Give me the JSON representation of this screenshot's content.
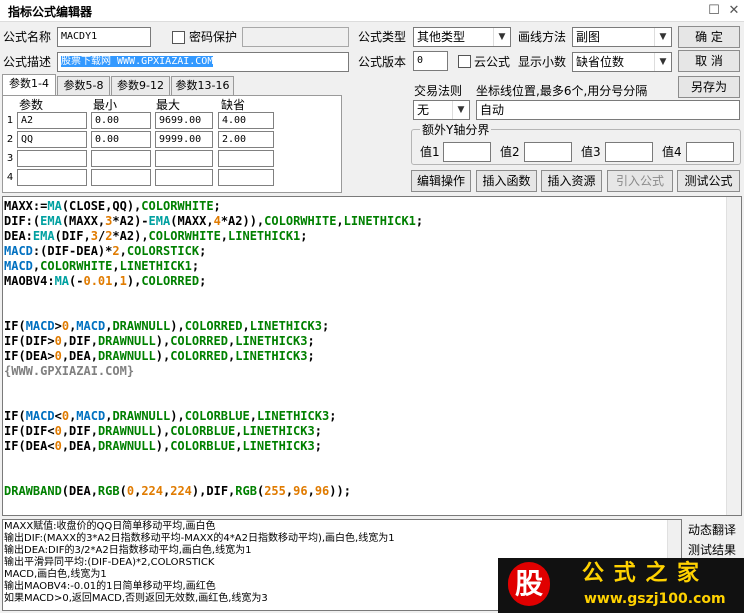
{
  "window": {
    "title": "指标公式编辑器",
    "restore_glyph": "☐",
    "close_glyph": "✕"
  },
  "form": {
    "name_label": "公式名称",
    "name_value": "MACDY1",
    "password_label": "密码保护",
    "desc_label": "公式描述",
    "desc_value": "股票下载网 WWW.GPXIAZAI.COM",
    "type_label": "公式类型",
    "type_value": "其他类型",
    "draw_label": "画线方法",
    "draw_value": "副图",
    "version_label": "公式版本",
    "version_value": "0",
    "cloud_label": "云公式",
    "decimals_label": "显示小数",
    "decimals_value": "缺省位数"
  },
  "buttons": {
    "ok": "确  定",
    "cancel": "取  消",
    "save_as": "另存为",
    "edit_op": "编辑操作",
    "insert_func": "插入函数",
    "insert_res": "插入资源",
    "import": "引入公式",
    "test": "测试公式"
  },
  "params": {
    "tabs": [
      "参数1-4",
      "参数5-8",
      "参数9-12",
      "参数13-16"
    ],
    "headers": [
      "参数",
      "最小",
      "最大",
      "缺省"
    ],
    "rows": [
      {
        "num": "1",
        "name": "A2",
        "min": "0.00",
        "max": "9699.00",
        "def": "4.00"
      },
      {
        "num": "2",
        "name": "QQ",
        "min": "0.00",
        "max": "9999.00",
        "def": "2.00"
      },
      {
        "num": "3",
        "name": "",
        "min": "",
        "max": "",
        "def": ""
      },
      {
        "num": "4",
        "name": "",
        "min": "",
        "max": "",
        "def": ""
      }
    ]
  },
  "trade": {
    "label": "交易法则",
    "value": "无"
  },
  "coord": {
    "label": "坐标线位置,最多6个,用分号分隔",
    "value": "自动"
  },
  "yaxis": {
    "label": "额外Y轴分界",
    "v1": "值1",
    "v2": "值2",
    "v3": "值3",
    "v4": "值4"
  },
  "code_lines": [
    [
      [
        "MAXX:=",
        "#000000"
      ],
      [
        "MA",
        "#00a0a0"
      ],
      [
        "(CLOSE,QQ),",
        "#000000"
      ],
      [
        "COLORWHITE",
        "#008000"
      ],
      [
        ";",
        "#000000"
      ]
    ],
    [
      [
        "DIF:(",
        "#000000"
      ],
      [
        "EMA",
        "#00a0a0"
      ],
      [
        "(MAXX,",
        "#000000"
      ],
      [
        "3",
        "#e07b00"
      ],
      [
        "*A2)-",
        "#000000"
      ],
      [
        "EMA",
        "#00a0a0"
      ],
      [
        "(MAXX,",
        "#000000"
      ],
      [
        "4",
        "#e07b00"
      ],
      [
        "*A2)),",
        "#000000"
      ],
      [
        "COLORWHITE",
        "#008000"
      ],
      [
        ",",
        "#000000"
      ],
      [
        "LINETHICK1",
        "#008000"
      ],
      [
        ";",
        "#000000"
      ]
    ],
    [
      [
        "DEA:",
        "#000000"
      ],
      [
        "EMA",
        "#00a0a0"
      ],
      [
        "(DIF,",
        "#000000"
      ],
      [
        "3",
        "#e07b00"
      ],
      [
        "/",
        "#000000"
      ],
      [
        "2",
        "#e07b00"
      ],
      [
        "*A2),",
        "#000000"
      ],
      [
        "COLORWHITE",
        "#008000"
      ],
      [
        ",",
        "#000000"
      ],
      [
        "LINETHICK1",
        "#008000"
      ],
      [
        ";",
        "#000000"
      ]
    ],
    [
      [
        "MACD",
        "#0070c0"
      ],
      [
        ":(DIF-DEA)*",
        "#000000"
      ],
      [
        "2",
        "#e07b00"
      ],
      [
        ",",
        "#000000"
      ],
      [
        "COLORSTICK",
        "#008000"
      ],
      [
        ";",
        "#000000"
      ]
    ],
    [
      [
        "MACD",
        "#0070c0"
      ],
      [
        ",",
        "#000000"
      ],
      [
        "COLORWHITE",
        "#008000"
      ],
      [
        ",",
        "#000000"
      ],
      [
        "LINETHICK1",
        "#008000"
      ],
      [
        ";",
        "#000000"
      ]
    ],
    [
      [
        "MAOBV4:",
        "#000000"
      ],
      [
        "MA",
        "#00a0a0"
      ],
      [
        "(-",
        "#000000"
      ],
      [
        "0.01",
        "#e07b00"
      ],
      [
        ",",
        "#000000"
      ],
      [
        "1",
        "#e07b00"
      ],
      [
        "),",
        "#000000"
      ],
      [
        "COLORRED",
        "#008000"
      ],
      [
        ";",
        "#000000"
      ]
    ],
    [],
    [],
    [
      [
        "IF",
        "#000000"
      ],
      [
        "(",
        "#000000"
      ],
      [
        "MACD",
        "#0070c0"
      ],
      [
        ">",
        "#000000"
      ],
      [
        "0",
        "#e07b00"
      ],
      [
        ",",
        "#000000"
      ],
      [
        "MACD",
        "#0070c0"
      ],
      [
        ",",
        "#000000"
      ],
      [
        "DRAWNULL",
        "#008000"
      ],
      [
        "),",
        "#000000"
      ],
      [
        "COLORRED",
        "#008000"
      ],
      [
        ",",
        "#000000"
      ],
      [
        "LINETHICK3",
        "#008000"
      ],
      [
        ";",
        "#000000"
      ]
    ],
    [
      [
        "IF",
        "#000000"
      ],
      [
        "(DIF>",
        "#000000"
      ],
      [
        "0",
        "#e07b00"
      ],
      [
        ",DIF,",
        "#000000"
      ],
      [
        "DRAWNULL",
        "#008000"
      ],
      [
        "),",
        "#000000"
      ],
      [
        "COLORRED",
        "#008000"
      ],
      [
        ",",
        "#000000"
      ],
      [
        "LINETHICK3",
        "#008000"
      ],
      [
        ";",
        "#000000"
      ]
    ],
    [
      [
        "IF",
        "#000000"
      ],
      [
        "(DEA>",
        "#000000"
      ],
      [
        "0",
        "#e07b00"
      ],
      [
        ",DEA,",
        "#000000"
      ],
      [
        "DRAWNULL",
        "#008000"
      ],
      [
        "),",
        "#000000"
      ],
      [
        "COLORRED",
        "#008000"
      ],
      [
        ",",
        "#000000"
      ],
      [
        "LINETHICK3",
        "#008000"
      ],
      [
        ";",
        "#000000"
      ]
    ],
    [
      [
        "{WWW.GPXIAZAI.COM}",
        "#808080"
      ]
    ],
    [],
    [],
    [
      [
        "IF",
        "#000000"
      ],
      [
        "(",
        "#000000"
      ],
      [
        "MACD",
        "#0070c0"
      ],
      [
        "<",
        "#000000"
      ],
      [
        "0",
        "#e07b00"
      ],
      [
        ",",
        "#000000"
      ],
      [
        "MACD",
        "#0070c0"
      ],
      [
        ",",
        "#000000"
      ],
      [
        "DRAWNULL",
        "#008000"
      ],
      [
        "),",
        "#000000"
      ],
      [
        "COLORBLUE",
        "#008000"
      ],
      [
        ",",
        "#000000"
      ],
      [
        "LINETHICK3",
        "#008000"
      ],
      [
        ";",
        "#000000"
      ]
    ],
    [
      [
        "IF",
        "#000000"
      ],
      [
        "(DIF<",
        "#000000"
      ],
      [
        "0",
        "#e07b00"
      ],
      [
        ",DIF,",
        "#000000"
      ],
      [
        "DRAWNULL",
        "#008000"
      ],
      [
        "),",
        "#000000"
      ],
      [
        "COLORBLUE",
        "#008000"
      ],
      [
        ",",
        "#000000"
      ],
      [
        "LINETHICK3",
        "#008000"
      ],
      [
        ";",
        "#000000"
      ]
    ],
    [
      [
        "IF",
        "#000000"
      ],
      [
        "(DEA<",
        "#000000"
      ],
      [
        "0",
        "#e07b00"
      ],
      [
        ",DEA,",
        "#000000"
      ],
      [
        "DRAWNULL",
        "#008000"
      ],
      [
        "),",
        "#000000"
      ],
      [
        "COLORBLUE",
        "#008000"
      ],
      [
        ",",
        "#000000"
      ],
      [
        "LINETHICK3",
        "#008000"
      ],
      [
        ";",
        "#000000"
      ]
    ],
    [],
    [],
    [
      [
        "DRAWBAND",
        "#008000"
      ],
      [
        "(DEA,",
        "#000000"
      ],
      [
        "RGB",
        "#008000"
      ],
      [
        "(",
        "#000000"
      ],
      [
        "0",
        "#e07b00"
      ],
      [
        ",",
        "#000000"
      ],
      [
        "224",
        "#e07b00"
      ],
      [
        ",",
        "#000000"
      ],
      [
        "224",
        "#e07b00"
      ],
      [
        "),DIF,",
        "#000000"
      ],
      [
        "RGB",
        "#008000"
      ],
      [
        "(",
        "#000000"
      ],
      [
        "255",
        "#e07b00"
      ],
      [
        ",",
        "#000000"
      ],
      [
        "96",
        "#e07b00"
      ],
      [
        ",",
        "#000000"
      ],
      [
        "96",
        "#e07b00"
      ],
      [
        "));",
        "#000000"
      ]
    ]
  ],
  "output_lines": [
    "MAXX赋值:收盘价的QQ日简单移动平均,画白色",
    "输出DIF:(MAXX的3*A2日指数移动平均-MAXX的4*A2日指数移动平均),画白色,线宽为1",
    "输出DEA:DIF的3/2*A2日指数移动平均,画白色,线宽为1",
    "输出平滑异同平均:(DIF-DEA)*2,COLORSTICK",
    "MACD,画白色,线宽为1",
    "输出MAOBV4:-0.01的1日简单移动平均,画红色",
    "如果MACD>0,返回MACD,否则返回无效数,画红色,线宽为3"
  ],
  "side": {
    "translate": "动态翻译",
    "test_result": "测试结果"
  },
  "watermark": {
    "logo_char": "股",
    "text": "公 式 之 家",
    "url": "www.gszj100.com",
    "color": "#ffd200"
  },
  "colors": {
    "accent": "#0078d7",
    "selection": "#3399ff",
    "number": "#e07b00",
    "keyword": "#008000",
    "func": "#00a0a0"
  }
}
